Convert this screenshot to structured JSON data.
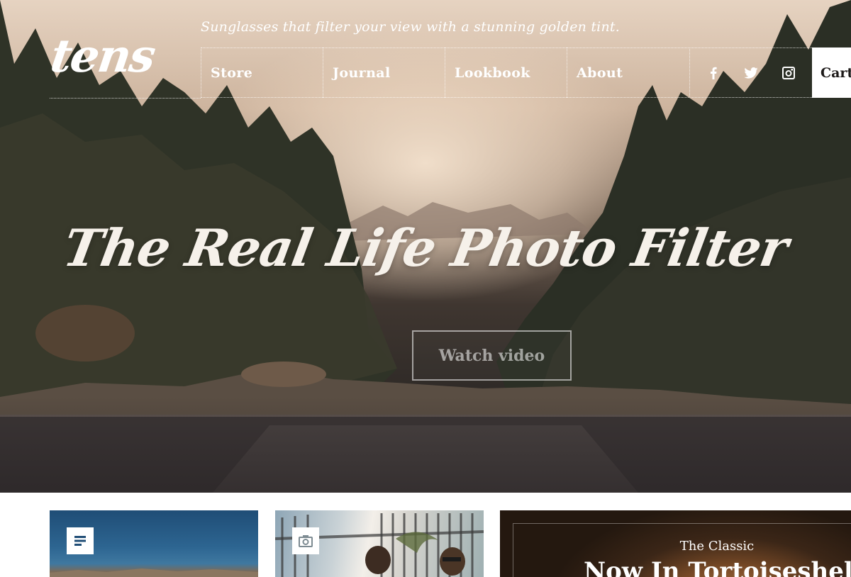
{
  "brand": {
    "logo_text": "tens",
    "tagline": "Sunglasses that filter your view with a stunning golden tint."
  },
  "nav": {
    "items": [
      {
        "label": "Store"
      },
      {
        "label": "Journal"
      },
      {
        "label": "Lookbook"
      },
      {
        "label": "About"
      }
    ],
    "social": [
      "facebook-icon",
      "twitter-icon",
      "instagram-icon"
    ],
    "cart_label": "Cart"
  },
  "hero": {
    "headline": "The Real Life Photo Filter",
    "cta_label": "Watch video"
  },
  "cards": [
    {
      "icon": "article-icon"
    },
    {
      "icon": "camera-icon"
    },
    {
      "kicker": "The Classic",
      "title": "Now In Tortoiseshell"
    }
  ],
  "colors": {
    "nav_text": "#ffffff",
    "cart_bg": "#ffffff",
    "cart_text": "#1d1a19",
    "headline": "#f6f1ea"
  }
}
